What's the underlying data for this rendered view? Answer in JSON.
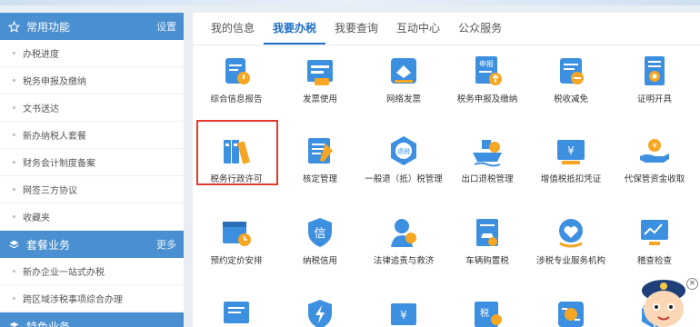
{
  "sidebar": {
    "sections": [
      {
        "title": "常用功能",
        "link": "设置",
        "icon": "star-icon"
      },
      {
        "title": "套餐业务",
        "link": "更多",
        "icon": "layers-icon"
      },
      {
        "title": "特色业务",
        "link": "",
        "icon": "layers-icon"
      }
    ],
    "common_items": [
      "办税进度",
      "税务申报及缴纳",
      "文书送达",
      "新办纳税人套餐",
      "财务会计制度备案",
      "网签三方协议",
      "收藏夹"
    ],
    "package_items": [
      "新办企业一站式办税",
      "跨区域涉税事项综合办理"
    ]
  },
  "tabs": [
    {
      "label": "我的信息",
      "active": false
    },
    {
      "label": "我要办税",
      "active": true
    },
    {
      "label": "我要查询",
      "active": false
    },
    {
      "label": "互动中心",
      "active": false
    },
    {
      "label": "公众服务",
      "active": false
    }
  ],
  "grid": {
    "row1": [
      "综合信息报告",
      "发票使用",
      "网络发票",
      "税务申报及缴纳",
      "税收减免",
      "证明开具"
    ],
    "row2": [
      "税务行政许可",
      "核定管理",
      "一般退（抵）税管理",
      "出口退税管理",
      "增值税抵扣凭证",
      "代保管资金收取"
    ],
    "row3": [
      "预约定价安排",
      "纳税信用",
      "法律追责与救济",
      "车辆购置税",
      "涉税专业服务机构",
      "稽查检查"
    ],
    "highlighted": "税务行政许可"
  },
  "icon_text": {
    "tui": "退税",
    "xin": "信",
    "shui": "税",
    "shenbao": "申报"
  },
  "colors": {
    "accent": "#1e6fc6",
    "sidebar_header": "#4a8fd0",
    "highlight": "#e23b2e",
    "orange": "#f5a623"
  }
}
